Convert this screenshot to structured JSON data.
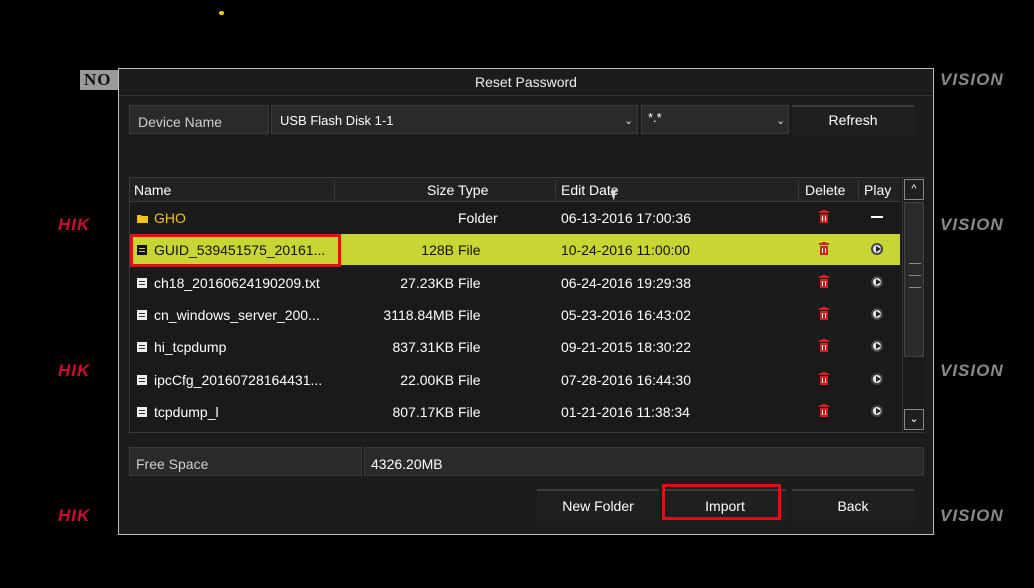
{
  "background": {
    "hik_logo": "HIK",
    "vision_logo": "VISION",
    "no_logo": "NO"
  },
  "dialog": {
    "title": "Reset Password",
    "device_label": "Device Name",
    "device_value": "USB Flash Disk 1-1",
    "filter_value": "*.*",
    "refresh_label": "Refresh",
    "columns": [
      "Name",
      "Size",
      "Type",
      "Edit Date",
      "Delete",
      "Play"
    ],
    "files": [
      {
        "name": "GHO",
        "size": "",
        "type": "Folder",
        "date": "06-13-2016 17:00:36",
        "kind": "folder"
      },
      {
        "name": "GUID_539451575_20161...",
        "size": "128B",
        "type": "File",
        "date": "10-24-2016 11:00:00",
        "kind": "file",
        "selected": true
      },
      {
        "name": "ch18_20160624190209.txt",
        "size": "27.23KB",
        "type": "File",
        "date": "06-24-2016 19:29:38",
        "kind": "file"
      },
      {
        "name": "cn_windows_server_200...",
        "size": "3118.84MB",
        "type": "File",
        "date": "05-23-2016 16:43:02",
        "kind": "file"
      },
      {
        "name": "hi_tcpdump",
        "size": "837.31KB",
        "type": "File",
        "date": "09-21-2015 18:30:22",
        "kind": "file"
      },
      {
        "name": "ipcCfg_20160728164431...",
        "size": "22.00KB",
        "type": "File",
        "date": "07-28-2016 16:44:30",
        "kind": "file"
      },
      {
        "name": "tcpdump_l",
        "size": "807.17KB",
        "type": "File",
        "date": "01-21-2016 11:38:34",
        "kind": "file"
      }
    ],
    "free_space_label": "Free Space",
    "free_space_value": "4326.20MB",
    "new_folder_label": "New Folder",
    "import_label": "Import",
    "back_label": "Back"
  },
  "colors": {
    "selected_row": "#c8d633",
    "highlight_box": "#dd1111",
    "folder_text": "#f0c419",
    "trash": "#d42020"
  },
  "icons": [
    "folder-icon",
    "file-icon",
    "trash-icon",
    "play-icon",
    "chevron-down-icon",
    "chevron-up-icon",
    "mouse-cursor-icon"
  ]
}
